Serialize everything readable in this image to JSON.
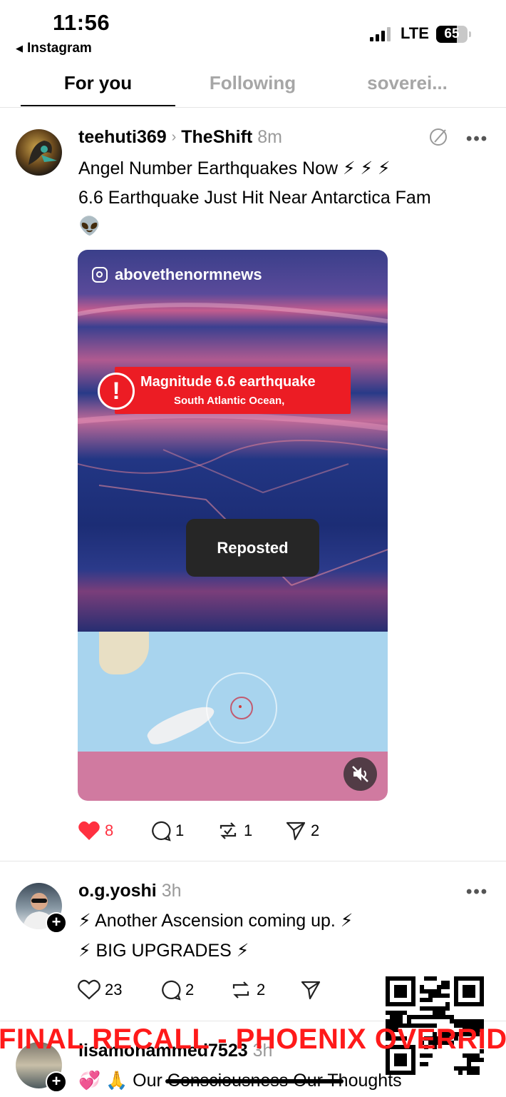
{
  "status_bar": {
    "time": "11:56",
    "back_app": "Instagram",
    "network": "LTE",
    "battery": "65",
    "battery_level_percent": 65
  },
  "tabs": [
    {
      "label": "For you",
      "active": true
    },
    {
      "label": "Following",
      "active": false
    },
    {
      "label": "soverei...",
      "active": false
    }
  ],
  "post1": {
    "username": "teehuti369",
    "community": "TheShift",
    "time": "8m",
    "text_line1": "Angel Number Earthquakes Now ⚡ ⚡ ⚡",
    "text_line2": "6.6 Earthquake Just Hit Near Antarctica Fam",
    "text_line3": "👽",
    "media": {
      "ig_handle": "abovethenormnews",
      "alert_title": "Magnitude 6.6 earthquake",
      "alert_subtitle": "South Atlantic Ocean,",
      "toast": "Reposted"
    },
    "likes": "8",
    "comments": "1",
    "reposts": "1",
    "shares": "2",
    "liked": true,
    "accent": "#ff3040"
  },
  "post2": {
    "username": "o.g.yoshi",
    "time": "3h",
    "text_line1": "⚡ Another Ascension coming up. ⚡",
    "text_line2": "⚡ BIG UPGRADES ⚡",
    "likes": "23",
    "comments": "2",
    "reposts": "2"
  },
  "post3": {
    "username": "lisamohammed7523",
    "time": "3h",
    "text_line1": "💞 🙏 Our Consciousness Our Thoughts"
  },
  "overlay": {
    "text": "FINAL RECALL - PHOENIX OVERRIDE",
    "color": "#ff1a1a"
  }
}
